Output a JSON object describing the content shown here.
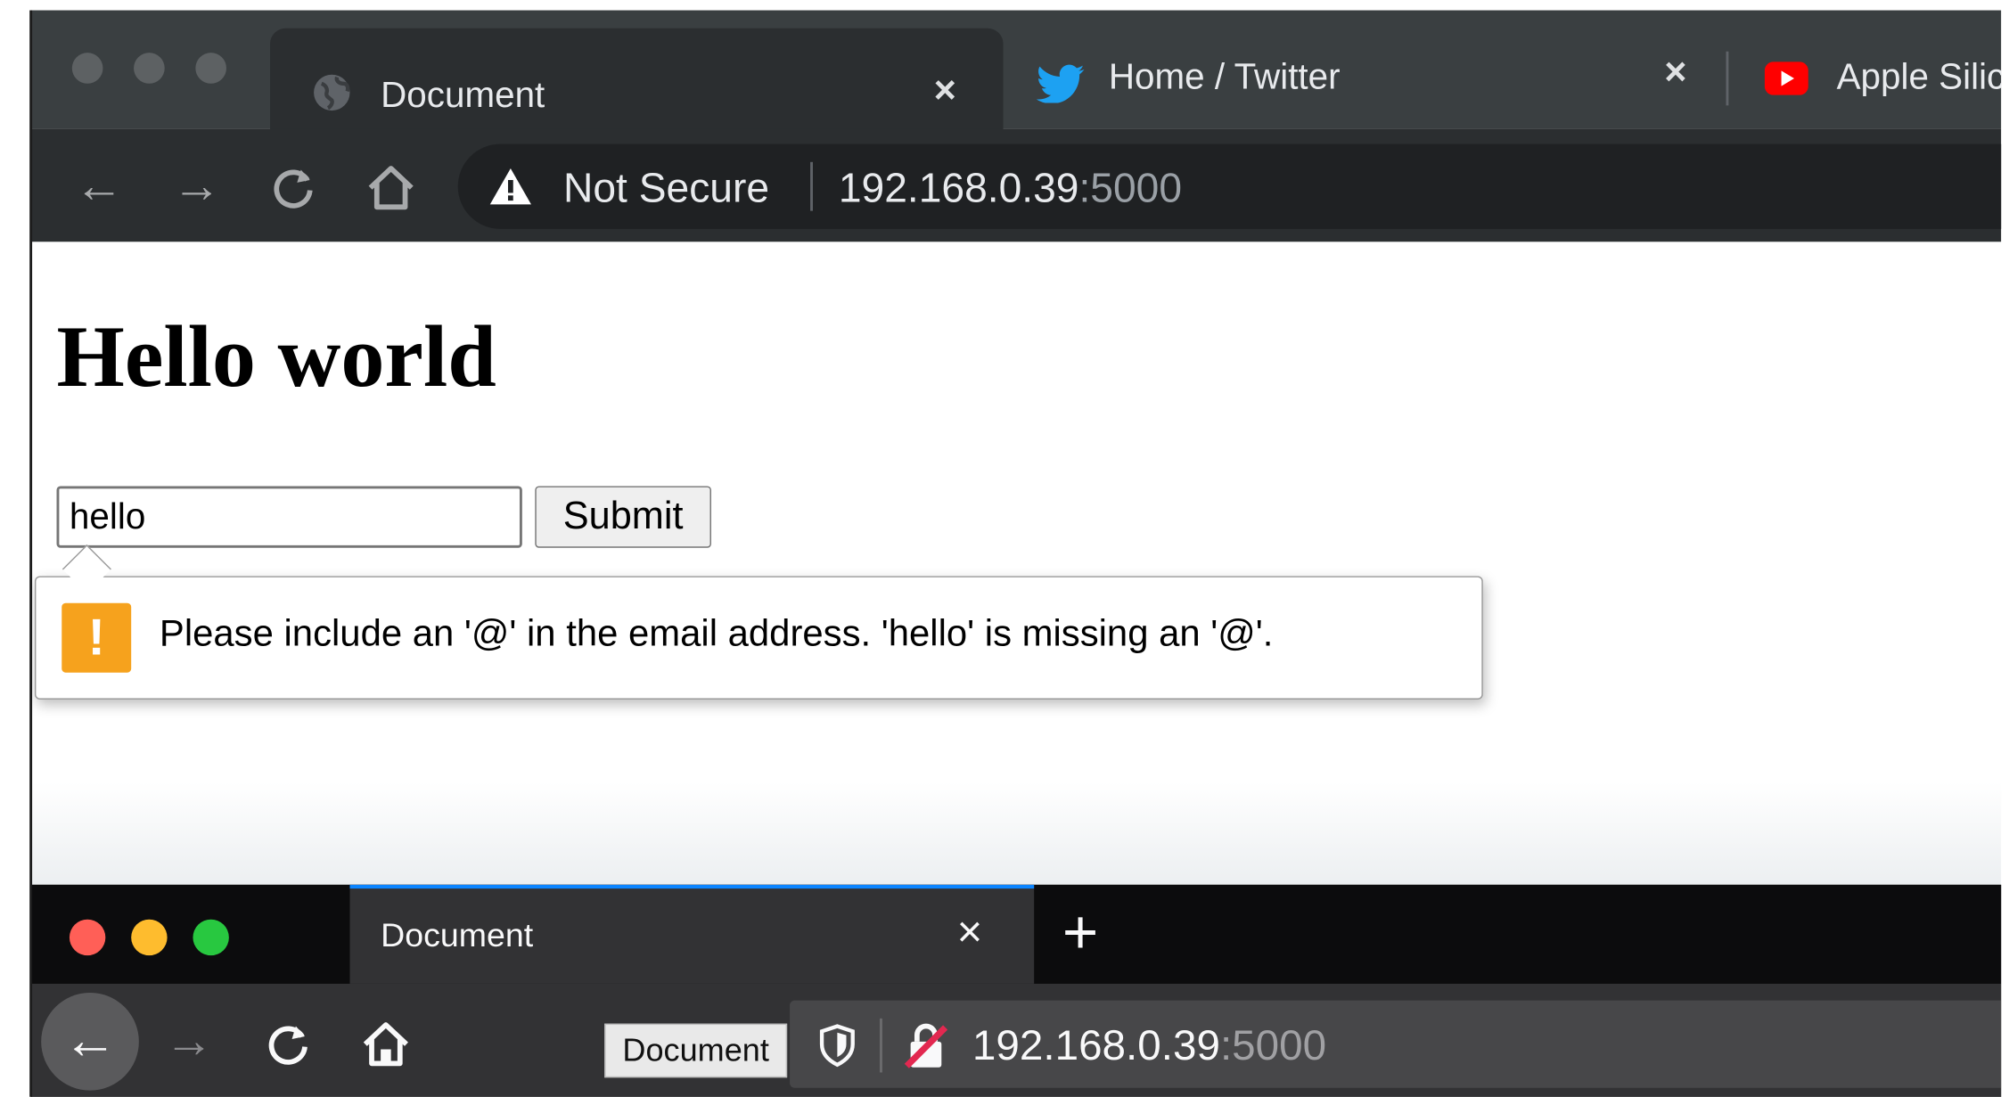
{
  "chrome": {
    "tabs": [
      {
        "title": "Document",
        "icon": "globe-icon",
        "active": true
      },
      {
        "title": "Home / Twitter",
        "icon": "twitter-icon",
        "active": false
      },
      {
        "title": "Apple Silic",
        "icon": "youtube-icon",
        "active": false
      }
    ],
    "close_glyph": "×",
    "nav": {
      "back": "←",
      "forward": "→",
      "reload": "C",
      "home": "⌂"
    },
    "security_label": "Not Secure",
    "url_host": "192.168.0.39",
    "url_port": ":5000"
  },
  "page": {
    "heading": "Hello world",
    "email_input_value": "hello",
    "submit_label": "Submit",
    "validation_message": "Please include an '@' in the email address. 'hello' is missing an '@'.",
    "validation_icon": "!"
  },
  "firefox": {
    "tab_title": "Document",
    "close_glyph": "×",
    "new_tab_glyph": "+",
    "nav": {
      "back": "←",
      "forward": "→",
      "reload": "C",
      "home": "⌂"
    },
    "tooltip": "Document",
    "url_host": "192.168.0.39",
    "url_port": ":5000",
    "colors": {
      "close": "#ff5f57",
      "minimize": "#febc2e",
      "maximize": "#28c840",
      "accent": "#0a84ff"
    }
  },
  "colors": {
    "chrome_tabstrip": "#3a3f41",
    "chrome_toolbar": "#2b2e30",
    "warning_orange": "#f6a21d",
    "twitter_blue": "#1da1f2",
    "youtube_red": "#ff0000"
  }
}
